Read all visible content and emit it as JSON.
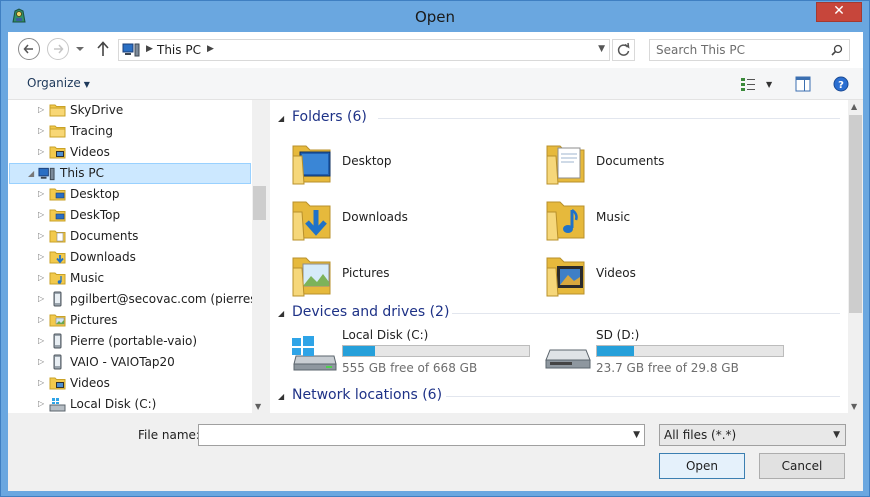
{
  "window": {
    "title": "Open",
    "close_label": "✕"
  },
  "address": {
    "location": "This PC",
    "search_placeholder": "Search This PC"
  },
  "toolbar": {
    "organize_label": "Organize"
  },
  "tree": {
    "items": [
      {
        "label": "SkyDrive",
        "icon": "folder-icon"
      },
      {
        "label": "Tracing",
        "icon": "folder-icon"
      },
      {
        "label": "Videos",
        "icon": "videos-folder-icon"
      },
      {
        "label": "This PC",
        "icon": "computer-icon"
      },
      {
        "label": "Desktop",
        "icon": "desktop-folder-icon"
      },
      {
        "label": "DeskTop",
        "icon": "desktop-folder-icon"
      },
      {
        "label": "Documents",
        "icon": "documents-folder-icon"
      },
      {
        "label": "Downloads",
        "icon": "downloads-folder-icon"
      },
      {
        "label": "Music",
        "icon": "music-folder-icon"
      },
      {
        "label": "pgilbert@secovac.com (pierresurfa",
        "icon": "phone-icon"
      },
      {
        "label": "Pictures",
        "icon": "pictures-folder-icon"
      },
      {
        "label": "Pierre (portable-vaio)",
        "icon": "phone-icon"
      },
      {
        "label": "VAIO - VAIOTap20",
        "icon": "phone-icon"
      },
      {
        "label": "Videos",
        "icon": "videos-folder-icon"
      },
      {
        "label": "Local Disk (C:)",
        "icon": "local-disk-icon"
      }
    ]
  },
  "content": {
    "folders_header": "Folders (6)",
    "folders": [
      {
        "label": "Desktop",
        "icon": "desktop-folder-icon"
      },
      {
        "label": "Documents",
        "icon": "documents-folder-icon"
      },
      {
        "label": "Downloads",
        "icon": "downloads-folder-icon"
      },
      {
        "label": "Music",
        "icon": "music-folder-icon"
      },
      {
        "label": "Pictures",
        "icon": "pictures-folder-icon"
      },
      {
        "label": "Videos",
        "icon": "videos-folder-icon"
      }
    ],
    "devices_header": "Devices and drives (2)",
    "drives": [
      {
        "name": "Local Disk (C:)",
        "free": "555 GB free of 668 GB",
        "used_fraction": 0.17,
        "icon": "windows-drive-icon"
      },
      {
        "name": "SD (D:)",
        "free": "23.7 GB free of 29.8 GB",
        "used_fraction": 0.2,
        "icon": "removable-drive-icon"
      }
    ],
    "network_header": "Network locations (6)"
  },
  "bottom": {
    "file_name_label": "File name:",
    "file_name_value": "",
    "file_type": "All files (*.*)",
    "open_label": "Open",
    "cancel_label": "Cancel"
  },
  "colors": {
    "accent": "#26a0da",
    "selection": "#cce8ff",
    "header_text": "#1e3287",
    "close": "#c7463b"
  }
}
